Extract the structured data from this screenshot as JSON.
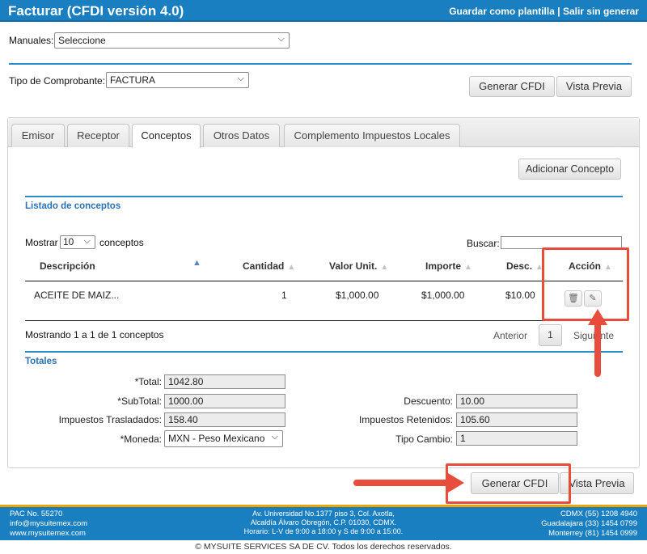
{
  "header": {
    "title": "Facturar (CFDI versión 4.0)",
    "save_template": "Guardar como plantilla",
    "separator": "|",
    "exit": "Salir sin generar"
  },
  "manuales": {
    "label": "Manuales:",
    "value": "Seleccione"
  },
  "tipo_comprobante": {
    "label": "Tipo de Comprobante:",
    "value": "FACTURA"
  },
  "top_buttons": {
    "generar": "Generar CFDI",
    "vista_previa": "Vista Previa"
  },
  "tabs": [
    {
      "label": "Emisor",
      "active": false
    },
    {
      "label": "Receptor",
      "active": false
    },
    {
      "label": "Conceptos",
      "active": true
    },
    {
      "label": "Otros Datos",
      "active": false
    },
    {
      "label": "Complemento Impuestos Locales",
      "active": false
    }
  ],
  "add_concept_button": "Adicionar Concepto",
  "listado": {
    "title": "Listado de conceptos",
    "show_label": "Mostrar",
    "show_value": "10",
    "show_suffix": "conceptos",
    "search_label": "Buscar:",
    "search_value": "",
    "columns": [
      "Descripción",
      "Cantidad",
      "Valor Unit.",
      "Importe",
      "Desc.",
      "Acción"
    ],
    "rows": [
      {
        "descripcion": "ACEITE DE MAIZ...",
        "cantidad": "1",
        "valor_unit": "$1,000.00",
        "importe": "$1,000.00",
        "desc": "$10.00"
      }
    ],
    "info": "Mostrando 1 a 1 de 1 conceptos",
    "pager": {
      "prev": "Anterior",
      "page": "1",
      "next": "Siguiente"
    }
  },
  "totales": {
    "title": "Totales",
    "total_label": "*Total:",
    "total_value": "1042.80",
    "subtotal_label": "*SubTotal:",
    "subtotal_value": "1000.00",
    "trasladados_label": "Impuestos Trasladados:",
    "trasladados_value": "158.40",
    "moneda_label": "*Moneda:",
    "moneda_value": "MXN - Peso Mexicano",
    "descuento_label": "Descuento:",
    "descuento_value": "10.00",
    "retenidos_label": "Impuestos Retenidos:",
    "retenidos_value": "105.60",
    "tipo_cambio_label": "Tipo Cambio:",
    "tipo_cambio_value": "1"
  },
  "bottom_buttons": {
    "generar": "Generar CFDI",
    "vista_previa": "Vista Previa"
  },
  "footer": {
    "left": [
      "PAC No. 55270",
      "info@mysuitemex.com",
      "www.mysuitemex.com"
    ],
    "center": [
      "Av. Universidad No.1377 piso 3, Col. Axotla,",
      "Alcaldía Álvaro Obregón, C.P. 01030, CDMX.",
      "Horario: L-V de 9:00 a 18:00 y S de 9:00 a 15:00."
    ],
    "right": [
      "CDMX (55) 1208 4940",
      "Guadalajara (33) 1454 0799",
      "Monterrey (81) 1454 0999"
    ],
    "copyright": "© MYSUITE SERVICES SA DE CV. Todos los derechos reservados."
  },
  "colors": {
    "brand_blue": "#1a7fc1",
    "highlight_red": "#e84c3d",
    "accent_orange": "#f0a400"
  }
}
